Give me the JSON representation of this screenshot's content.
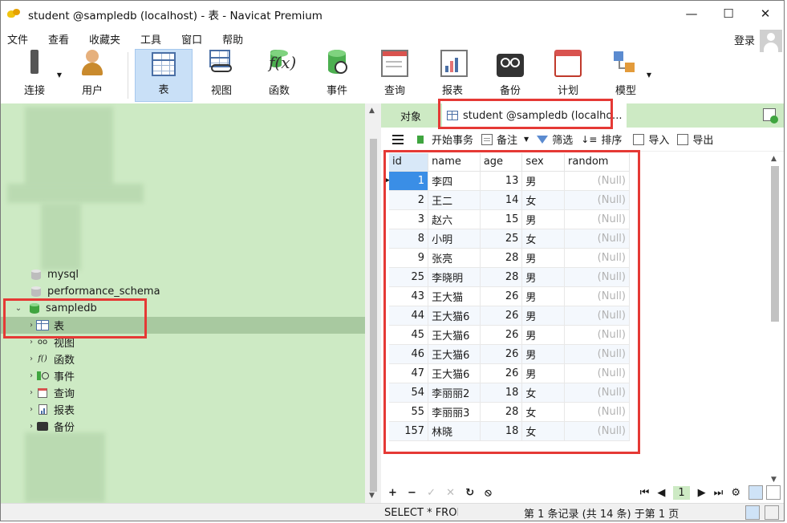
{
  "window": {
    "title": "student @sampledb (localhost) - 表 - Navicat Premium",
    "minimize": "—",
    "maximize": "☐",
    "close": "✕"
  },
  "menu": [
    "文件",
    "查看",
    "收藏夹",
    "工具",
    "窗口",
    "帮助"
  ],
  "login": "登录",
  "toolbar": [
    {
      "label": "连接",
      "icon": "plug-icon"
    },
    {
      "label": "用户",
      "icon": "user-icon"
    },
    {
      "label": "表",
      "icon": "table-icon",
      "active": true
    },
    {
      "label": "视图",
      "icon": "view-icon"
    },
    {
      "label": "函数",
      "icon": "function-icon"
    },
    {
      "label": "事件",
      "icon": "event-icon"
    },
    {
      "label": "查询",
      "icon": "query-icon"
    },
    {
      "label": "报表",
      "icon": "report-icon"
    },
    {
      "label": "备份",
      "icon": "backup-icon"
    },
    {
      "label": "计划",
      "icon": "schedule-icon"
    },
    {
      "label": "模型",
      "icon": "model-icon"
    }
  ],
  "nav": {
    "databases": [
      "mysql",
      "performance_schema",
      "sampledb"
    ],
    "sampledb_children": [
      "表",
      "视图",
      "函数",
      "事件",
      "查询",
      "报表",
      "备份"
    ],
    "view_prefix": "oo",
    "fx_prefix": "f()"
  },
  "tabs": {
    "objects": "对象",
    "active": "student @sampledb (localho..."
  },
  "content_toolbar": {
    "begin_transaction": "开始事务",
    "memo": "备注",
    "filter": "筛选",
    "sort": "排序",
    "import": "导入",
    "export": "导出"
  },
  "grid": {
    "columns": [
      "id",
      "name",
      "age",
      "sex",
      "random"
    ],
    "null_text": "(Null)",
    "rows": [
      {
        "id": "1",
        "name": "李四",
        "age": "13",
        "sex": "男"
      },
      {
        "id": "2",
        "name": "王二",
        "age": "14",
        "sex": "女"
      },
      {
        "id": "3",
        "name": "赵六",
        "age": "15",
        "sex": "男"
      },
      {
        "id": "8",
        "name": "小明",
        "age": "25",
        "sex": "女"
      },
      {
        "id": "9",
        "name": "张亮",
        "age": "28",
        "sex": "男"
      },
      {
        "id": "25",
        "name": "李晓明",
        "age": "28",
        "sex": "男"
      },
      {
        "id": "43",
        "name": "王大猫",
        "age": "26",
        "sex": "男"
      },
      {
        "id": "44",
        "name": "王大猫6",
        "age": "26",
        "sex": "男"
      },
      {
        "id": "45",
        "name": "王大猫6",
        "age": "26",
        "sex": "男"
      },
      {
        "id": "46",
        "name": "王大猫6",
        "age": "26",
        "sex": "男"
      },
      {
        "id": "47",
        "name": "王大猫6",
        "age": "26",
        "sex": "男"
      },
      {
        "id": "54",
        "name": "李丽丽2",
        "age": "18",
        "sex": "女"
      },
      {
        "id": "55",
        "name": "李丽丽3",
        "age": "28",
        "sex": "女"
      },
      {
        "id": "157",
        "name": "林晓",
        "age": "18",
        "sex": "女"
      }
    ]
  },
  "footer": {
    "add": "+",
    "delete": "−",
    "apply": "✓",
    "discard": "✕",
    "refresh": "↻",
    "stop": "⦸",
    "first": "⏮",
    "prev": "◀",
    "page": "1",
    "next": "▶",
    "last": "⏭",
    "settings": "⚙"
  },
  "status": {
    "sql": "SELECT * FROM `student`",
    "records": "第 1 条记录 (共 14 条) 于第 1 页"
  },
  "colors": {
    "nav_bg": "#cdeac4",
    "annotation": "#e53935",
    "cursor": "#3a8ee6"
  }
}
